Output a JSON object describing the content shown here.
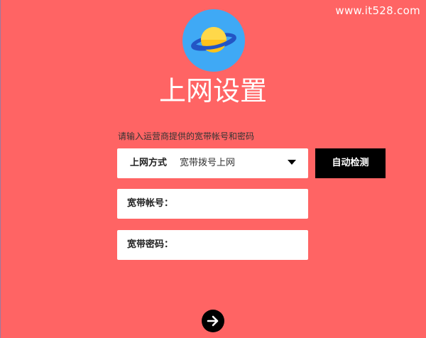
{
  "watermark": "www.it528.com",
  "title": "上网设置",
  "hint": "请输入运营商提供的宽带帐号和密码",
  "form": {
    "mode_label": "上网方式",
    "mode_value": "宽带拨号上网",
    "detect_button": "自动检测",
    "account_label": "宽带帐号：",
    "account_value": "",
    "password_label": "宽带密码：",
    "password_value": ""
  },
  "icons": {
    "logo": "planet-icon",
    "caret": "chevron-down-icon",
    "next": "arrow-right-icon"
  },
  "colors": {
    "background": "#ff6464",
    "button": "#000000",
    "field": "#ffffff",
    "logo_circle": "#3fa9f5",
    "planet": "#ffc21a",
    "ring": "#2355c5"
  }
}
